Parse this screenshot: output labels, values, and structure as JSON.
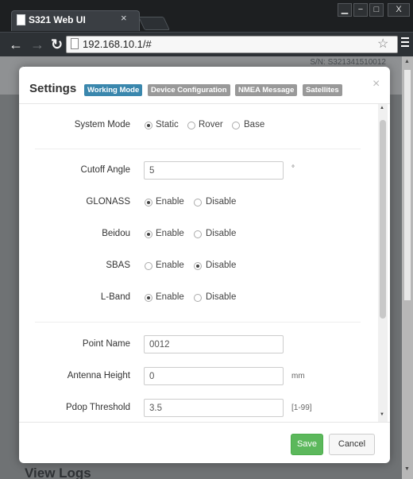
{
  "browser": {
    "tab_title": "S321 Web UI",
    "tab_close": "×",
    "url": "192.168.10.1/#",
    "window_controls": [
      "−",
      "□",
      "X"
    ]
  },
  "page": {
    "serial": "S/N: S321341510012",
    "view_logs": "View Logs"
  },
  "modal": {
    "title": "Settings",
    "tabs": [
      {
        "label": "Working Mode",
        "active": true
      },
      {
        "label": "Device Configuration",
        "active": false
      },
      {
        "label": "NMEA Message",
        "active": false
      },
      {
        "label": "Satellites",
        "active": false
      }
    ],
    "close": "×",
    "system_mode": {
      "label": "System Mode",
      "options": [
        "Static",
        "Rover",
        "Base"
      ],
      "selected": "Static"
    },
    "cutoff_angle": {
      "label": "Cutoff Angle",
      "value": "5",
      "unit": "°"
    },
    "glonass": {
      "label": "GLONASS",
      "enable": "Enable",
      "disable": "Disable",
      "selected": "Enable"
    },
    "beidou": {
      "label": "Beidou",
      "enable": "Enable",
      "disable": "Disable",
      "selected": "Enable"
    },
    "sbas": {
      "label": "SBAS",
      "enable": "Enable",
      "disable": "Disable",
      "selected": "Disable"
    },
    "lband": {
      "label": "L-Band",
      "enable": "Enable",
      "disable": "Disable",
      "selected": "Enable"
    },
    "point_name": {
      "label": "Point Name",
      "value": "0012"
    },
    "antenna_height": {
      "label": "Antenna Height",
      "value": "0",
      "unit": "mm"
    },
    "pdop_threshold": {
      "label": "Pdop Threshold",
      "value": "3.5",
      "unit": "[1-99]"
    },
    "save_label": "Save",
    "cancel_label": "Cancel"
  }
}
